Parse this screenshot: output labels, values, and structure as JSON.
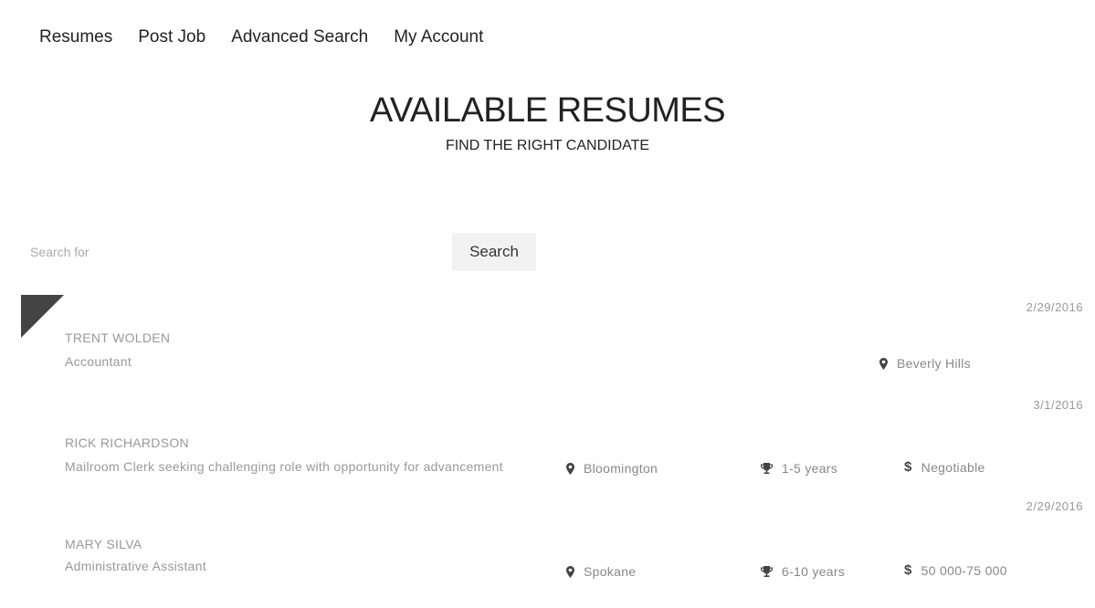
{
  "nav": {
    "items": [
      "Resumes",
      "Post Job",
      "Advanced Search",
      "My Account"
    ]
  },
  "hero": {
    "title": "AVAILABLE RESUMES",
    "subtitle": "FIND THE RIGHT CANDIDATE"
  },
  "search": {
    "placeholder": "Search for",
    "button_label": "Search"
  },
  "resumes": [
    {
      "date": "2/29/2016",
      "name": "TRENT WOLDEN",
      "title": "Accountant",
      "location": "Beverly Hills",
      "experience": "",
      "salary": ""
    },
    {
      "date": "3/1/2016",
      "name": "RICK RICHARDSON",
      "title": "Mailroom Clerk seeking challenging role with opportunity for advancement",
      "location": "Bloomington",
      "experience": "1-5 years",
      "salary": "Negotiable"
    },
    {
      "date": "2/29/2016",
      "name": "MARY SILVA",
      "title": "Administrative Assistant",
      "location": "Spokane",
      "experience": "6-10 years",
      "salary": "50 000-75 000"
    }
  ],
  "icons": {
    "location": "map-pin-icon",
    "experience": "trophy-icon",
    "salary": "dollar-icon"
  },
  "colors": {
    "flag": "#444444",
    "muted_text": "#999999",
    "button_bg": "#f2f2f2"
  }
}
